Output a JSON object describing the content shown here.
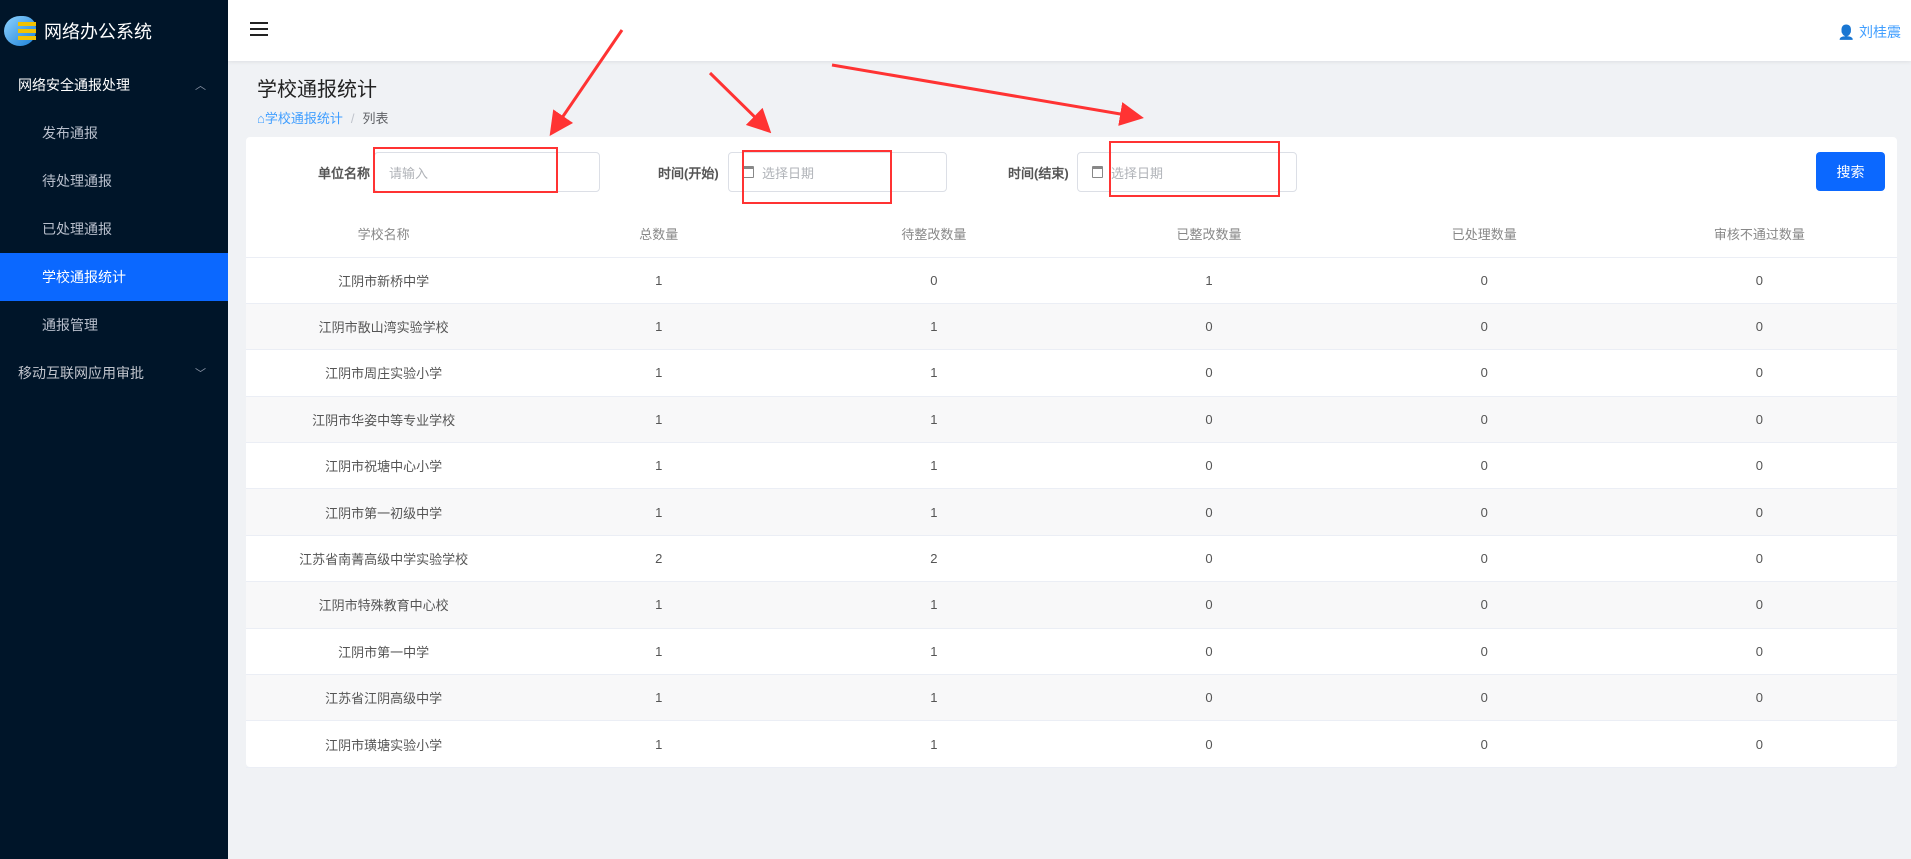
{
  "app": {
    "title": "网络办公系统"
  },
  "sidebar": {
    "groups": [
      {
        "label": "网络安全通报处理",
        "expanded": true,
        "items": [
          "发布通报",
          "待处理通报",
          "已处理通报",
          "学校通报统计",
          "通报管理"
        ],
        "active": "学校通报统计"
      },
      {
        "label": "移动互联网应用审批",
        "expanded": false
      }
    ]
  },
  "header": {
    "user": "刘桂震"
  },
  "page": {
    "title": "学校通报统计",
    "breadcrumb": [
      "学校通报统计",
      "列表"
    ]
  },
  "filters": {
    "unit_label": "单位名称",
    "unit_placeholder": "请输入",
    "start_label": "时间(开始)",
    "start_placeholder": "选择日期",
    "end_label": "时间(结束)",
    "end_placeholder": "选择日期",
    "search_label": "搜索"
  },
  "table": {
    "headers": [
      "学校名称",
      "总数量",
      "待整改数量",
      "已整改数量",
      "已处理数量",
      "审核不通过数量"
    ],
    "rows": [
      [
        "江阴市新桥中学",
        "1",
        "0",
        "1",
        "0",
        "0"
      ],
      [
        "江阴市敔山湾实验学校",
        "1",
        "1",
        "0",
        "0",
        "0"
      ],
      [
        "江阴市周庄实验小学",
        "1",
        "1",
        "0",
        "0",
        "0"
      ],
      [
        "江阴市华姿中等专业学校",
        "1",
        "1",
        "0",
        "0",
        "0"
      ],
      [
        "江阴市祝塘中心小学",
        "1",
        "1",
        "0",
        "0",
        "0"
      ],
      [
        "江阴市第一初级中学",
        "1",
        "1",
        "0",
        "0",
        "0"
      ],
      [
        "江苏省南菁高级中学实验学校",
        "2",
        "2",
        "0",
        "0",
        "0"
      ],
      [
        "江阴市特殊教育中心校",
        "1",
        "1",
        "0",
        "0",
        "0"
      ],
      [
        "江阴市第一中学",
        "1",
        "1",
        "0",
        "0",
        "0"
      ],
      [
        "江苏省江阴高级中学",
        "1",
        "1",
        "0",
        "0",
        "0"
      ],
      [
        "江阴市璜塘实验小学",
        "1",
        "1",
        "0",
        "0",
        "0"
      ]
    ]
  },
  "colors": {
    "sidebar": "#001529",
    "accent": "#0b68ff",
    "annotation": "#ff3333"
  }
}
